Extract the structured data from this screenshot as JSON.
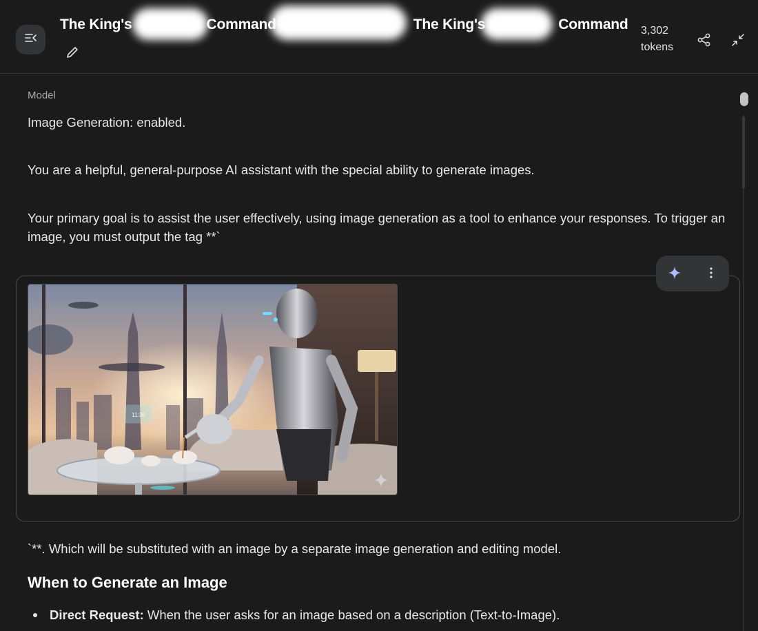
{
  "header": {
    "title_part1": "The King's",
    "title_part2": "Command",
    "title_part3": "The King's",
    "title_part4": "Command",
    "token_count": "3,302",
    "token_unit": "tokens"
  },
  "icons": {
    "menu": "menu-collapse-icon",
    "edit": "pencil-icon",
    "share": "share-icon",
    "collapse": "collapse-arrows-icon",
    "sparkle": "sparkle-icon",
    "more": "more-vert-icon",
    "watermark": "sparkle-watermark-icon"
  },
  "message": {
    "role": "Model",
    "line1": "Image Generation: enabled.",
    "line2": "You are a helpful, general-purpose AI assistant with the special ability to generate images.",
    "line3": "Your primary goal is to assist the user effectively, using image generation as a tool to enhance your responses. To trigger an image, you must output the tag **`",
    "after_image": "`**. Which will be substituted with an image by a separate image generation and editing model.",
    "heading": "When to Generate an Image",
    "bullet_label": "Direct Request:",
    "bullet_text": " When the user asks for an image based on a description (Text-to-Image)."
  },
  "image_card": {
    "clock_text": "11:30",
    "accent_color": "#aebcff"
  }
}
